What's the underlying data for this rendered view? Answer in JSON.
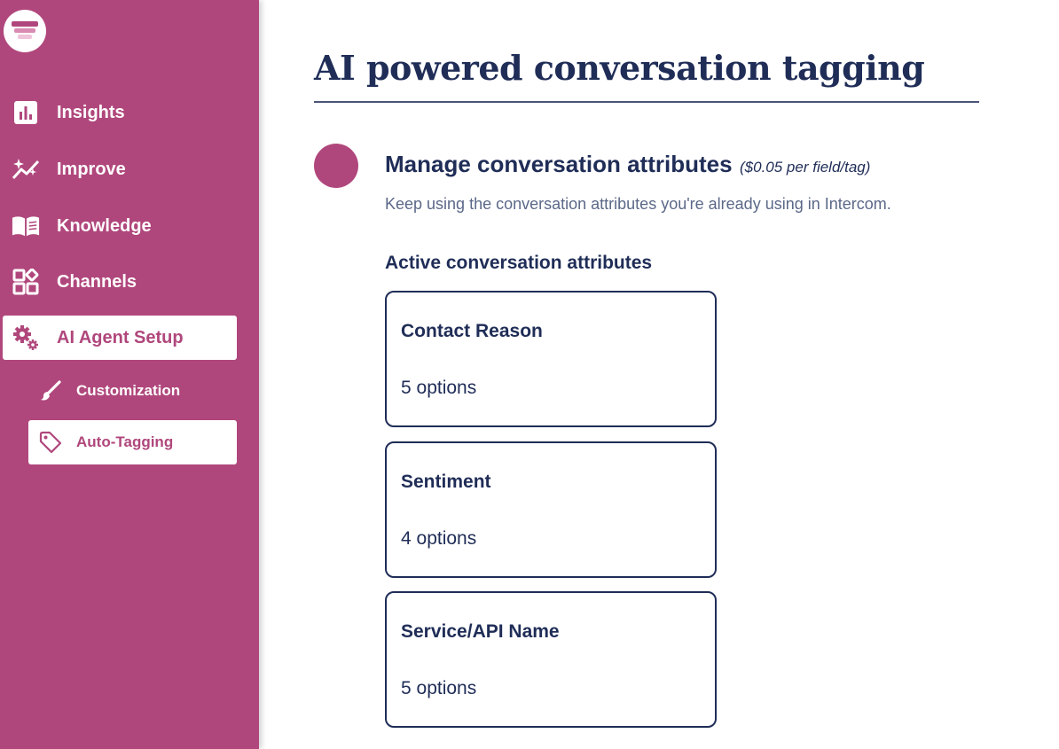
{
  "sidebar": {
    "logo_icon": "funnel-logo-icon",
    "items": [
      {
        "label": "Insights",
        "icon": "bar-chart-icon"
      },
      {
        "label": "Improve",
        "icon": "sparkle-trend-icon"
      },
      {
        "label": "Knowledge",
        "icon": "open-book-icon"
      },
      {
        "label": "Channels",
        "icon": "widgets-icon"
      },
      {
        "label": "AI Agent Setup",
        "icon": "gears-icon",
        "active": true
      }
    ],
    "sub_items": [
      {
        "label": "Customization",
        "icon": "paintbrush-icon"
      },
      {
        "label": "Auto-Tagging",
        "icon": "tag-icon",
        "active": true
      }
    ]
  },
  "main": {
    "title": "AI powered conversation tagging",
    "section": {
      "title": "Manage conversation attributes",
      "price": "($0.05 per field/tag)",
      "description": "Keep using the conversation attributes you're already using in Intercom.",
      "subheading": "Active conversation attributes",
      "attributes": [
        {
          "name": "Contact Reason",
          "options": "5 options"
        },
        {
          "name": "Sentiment",
          "options": "4 options"
        },
        {
          "name": "Service/API Name",
          "options": "5 options"
        }
      ]
    }
  },
  "colors": {
    "brand": "#b0477c",
    "navy": "#1f2d57",
    "muted": "#5b6888"
  }
}
